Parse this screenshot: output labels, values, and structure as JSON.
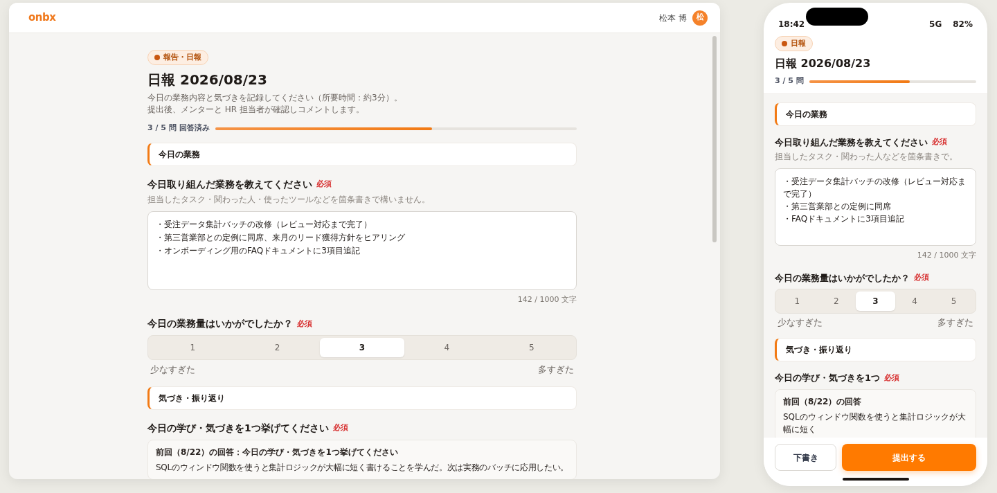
{
  "desktop": {
    "logo": "onbx",
    "user_name": "松本 博",
    "avatar_initial": "松",
    "tag": "報告・日報",
    "title": "日報 2026/08/23",
    "description": [
      "今日の業務内容と気づきを記録してください（所要時間：約3分）。",
      "提出後、メンターと HR 担当者が確認しコメントします。"
    ],
    "progress": {
      "label": "3 / 5 問 回答済み",
      "level": 0.6
    },
    "blocks": [
      {
        "kind": "section",
        "title": "今日の業務"
      },
      {
        "kind": "textarea",
        "label": "今日取り組んだ業務を教えてください",
        "required": "必須",
        "hint": "担当したタスク・関わった人・使ったツールなどを箇条書きで構いません。",
        "lines": [
          "・受注データ集計バッチの改修（レビュー対応まで完了）",
          "・第三営業部との定例に同席、来月のリード獲得方針をヒアリング",
          "・オンボーディング用のFAQドキュメントに3項目追記"
        ],
        "counter": "142 / 1000 文字"
      },
      {
        "kind": "scale",
        "label": "今日の業務量はいかがでしたか？",
        "required": "必須",
        "options": [
          {
            "label": "1",
            "selected": false
          },
          {
            "label": "2",
            "selected": false
          },
          {
            "label": "3",
            "selected": true
          },
          {
            "label": "4",
            "selected": false
          },
          {
            "label": "5",
            "selected": false
          }
        ],
        "low": "少なすぎた",
        "high": "多すぎた"
      },
      {
        "kind": "section",
        "title": "気づき・振り返り"
      },
      {
        "kind": "previous",
        "label": "今日の学び・気づきを1つ挙げてください",
        "required": "必須",
        "previous_title": "前回（8/22）の回答：今日の学び・気づきを1つ挙げてください",
        "previous_text": "SQLのウィンドウ関数を使うと集計ロジックが大幅に短く書けることを学んだ。次は実務のバッチに応用したい。"
      }
    ]
  },
  "mobile": {
    "time": "18:42",
    "network": "5G",
    "battery": "82%",
    "tag": "日報",
    "title": "日報 2026/08/23",
    "progress": {
      "label": "3 / 5 問",
      "level": 0.6
    },
    "blocks": [
      {
        "kind": "section",
        "title": "今日の業務"
      },
      {
        "kind": "textarea",
        "label": "今日取り組んだ業務を教えてください",
        "required": "必須",
        "hint": "担当したタスク・関わった人などを箇条書きで。",
        "lines": [
          "・受注データ集計バッチの改修（レビュー対応まで完了）",
          "・第三営業部との定例に同席",
          "・FAQドキュメントに3項目追記"
        ],
        "counter": "142 / 1000 文字"
      },
      {
        "kind": "scale",
        "label": "今日の業務量はいかがでしたか？",
        "required": "必須",
        "options": [
          {
            "label": "1",
            "selected": false
          },
          {
            "label": "2",
            "selected": false
          },
          {
            "label": "3",
            "selected": true
          },
          {
            "label": "4",
            "selected": false
          },
          {
            "label": "5",
            "selected": false
          }
        ],
        "low": "少なすぎた",
        "high": "多すぎた"
      },
      {
        "kind": "section",
        "title": "気づき・振り返り"
      },
      {
        "kind": "previous",
        "label": "今日の学び・気づきを1つ",
        "required": "必須",
        "previous_title": "前回（8/22）の回答",
        "previous_text": "SQLのウィンドウ関数を使うと集計ロジックが大幅に短く"
      }
    ],
    "buttons": {
      "draft": "下書き",
      "submit": "提出する"
    }
  }
}
